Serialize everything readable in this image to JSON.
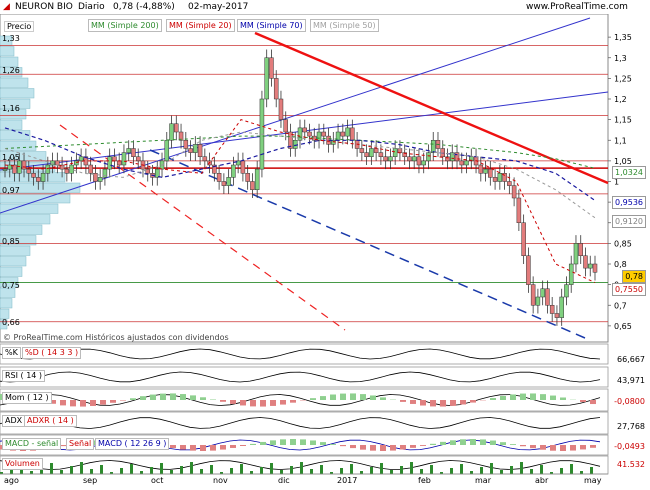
{
  "header": {
    "logo_text": "NEURON BIO",
    "period": "Diario",
    "last": "0,78 (-4,88%)",
    "date": "02-may-2017",
    "site": "www.ProRealTime.com"
  },
  "main_panel": {
    "price_label": "Precio",
    "watermark": "© ProRealTime.com   Históricos ajustados con dividendos",
    "ma_legend": [
      {
        "label": "MM (Simple 200)",
        "color": "#2e8b2e"
      },
      {
        "label": "MM (Simple 20)",
        "color": "#cc0000"
      },
      {
        "label": "MM (Simple 70)",
        "color": "#0000aa"
      },
      {
        "label": "MM (Simple 50)",
        "color": "#a0a0a0"
      }
    ],
    "left_volume_profile_labels": [
      "1,33",
      "1,26",
      "1,16",
      "1,05",
      "0,97",
      "0,85",
      "0,75",
      "0,66"
    ],
    "right_axis_ticks": [
      "1,35",
      "1,3",
      "1,25",
      "1,2",
      "1,15",
      "1,1",
      "1,05",
      "1",
      "0,95",
      "0,9",
      "0,85",
      "0,8",
      "0,75",
      "0,7",
      "0,65"
    ],
    "value_badges": [
      {
        "value": "1,0324",
        "color": "#2e8b2e"
      },
      {
        "value": "0,9536",
        "color": "#0000aa"
      },
      {
        "value": "0,9120",
        "color": "#808080"
      },
      {
        "value": "0,78",
        "color": "#000000",
        "bg": "#ffcc00"
      },
      {
        "value": "0,7550",
        "color": "#cc0000"
      }
    ]
  },
  "subpanels": [
    {
      "name": "stochastic",
      "labels": [
        "%K",
        "%D ( 14 3 3 )"
      ],
      "value": "66,667",
      "ticks": []
    },
    {
      "name": "rsi",
      "labels": [
        "RSI ( 14 )"
      ],
      "value": "43,971",
      "ticks": []
    },
    {
      "name": "momentum",
      "labels": [
        "Mom ( 12 )"
      ],
      "value": "-0,0800",
      "ticks": []
    },
    {
      "name": "adx",
      "labels": [
        "ADX",
        "ADXR ( 14 )"
      ],
      "value": "27,768",
      "ticks": []
    },
    {
      "name": "macd",
      "labels": [
        "MACD - señal",
        "Señal",
        "MACD ( 12 26 9 )"
      ],
      "value": "-0,0493",
      "ticks": []
    },
    {
      "name": "volume",
      "labels": [
        "Volumen"
      ],
      "value": "41.532",
      "ticks": []
    }
  ],
  "chart_data": {
    "type": "candlestick",
    "title": "NEURON BIO",
    "x_ticks": [
      "ago",
      "sep",
      "oct",
      "nov",
      "dic",
      "2017",
      "feb",
      "mar",
      "abr",
      "may"
    ],
    "ylim": [
      0.64,
      1.36
    ],
    "y_ticks": [
      1.35,
      1.3,
      1.25,
      1.2,
      1.15,
      1.1,
      1.05,
      1.0,
      0.95,
      0.9,
      0.85,
      0.8,
      0.75,
      0.7,
      0.65
    ],
    "horizontal_levels": [
      1.33,
      1.26,
      1.16,
      1.05,
      1.0324,
      0.97,
      0.85,
      0.755,
      0.66
    ],
    "close_series": [
      1.03,
      1.04,
      1.02,
      1.05,
      1.03,
      1.02,
      1.01,
      1.0,
      1.02,
      1.04,
      1.05,
      1.04,
      1.03,
      1.02,
      1.04,
      1.05,
      1.06,
      1.04,
      1.02,
      1.0,
      1.01,
      1.03,
      1.06,
      1.05,
      1.04,
      1.07,
      1.08,
      1.06,
      1.05,
      1.03,
      1.02,
      1.01,
      1.03,
      1.05,
      1.1,
      1.14,
      1.12,
      1.1,
      1.08,
      1.07,
      1.09,
      1.06,
      1.05,
      1.04,
      1.02,
      1.0,
      0.99,
      1.01,
      1.04,
      1.05,
      1.02,
      1.0,
      0.98,
      1.03,
      1.2,
      1.3,
      1.25,
      1.2,
      1.15,
      1.12,
      1.08,
      1.1,
      1.13,
      1.12,
      1.11,
      1.1,
      1.12,
      1.11,
      1.09,
      1.1,
      1.12,
      1.11,
      1.13,
      1.1,
      1.08,
      1.07,
      1.06,
      1.08,
      1.07,
      1.06,
      1.05,
      1.06,
      1.08,
      1.07,
      1.06,
      1.05,
      1.06,
      1.04,
      1.05,
      1.07,
      1.1,
      1.08,
      1.06,
      1.05,
      1.07,
      1.05,
      1.04,
      1.05,
      1.06,
      1.04,
      1.02,
      1.03,
      1.01,
      1.0,
      1.02,
      1.0,
      0.99,
      0.96,
      0.9,
      0.82,
      0.75,
      0.7,
      0.72,
      0.74,
      0.7,
      0.68,
      0.67,
      0.72,
      0.75,
      0.8,
      0.85,
      0.82,
      0.79,
      0.8,
      0.78
    ],
    "series": [
      {
        "name": "MM (Simple 200)",
        "values": [
          1.08,
          1.085,
          1.09,
          1.095,
          1.1,
          1.105,
          1.11,
          1.11,
          1.105,
          1.1,
          1.095,
          1.09,
          1.08,
          1.07,
          1.055,
          1.032
        ]
      },
      {
        "name": "MM (Simple 70)",
        "values": [
          1.13,
          1.1,
          1.06,
          1.03,
          1.01,
          1.03,
          1.05,
          1.08,
          1.1,
          1.1,
          1.09,
          1.07,
          1.06,
          1.05,
          1.02,
          0.954
        ]
      },
      {
        "name": "MM (Simple 50)",
        "values": [
          1.08,
          1.05,
          1.02,
          1.01,
          1.04,
          1.1,
          1.12,
          1.11,
          1.1,
          1.09,
          1.08,
          1.07,
          1.06,
          1.03,
          0.98,
          0.912
        ]
      },
      {
        "name": "MM (Simple 20)",
        "values": [
          1.04,
          1.03,
          1.05,
          1.05,
          1.03,
          1.02,
          1.15,
          1.12,
          1.1,
          1.09,
          1.07,
          1.06,
          1.05,
          1.0,
          0.8,
          0.755
        ]
      }
    ]
  }
}
